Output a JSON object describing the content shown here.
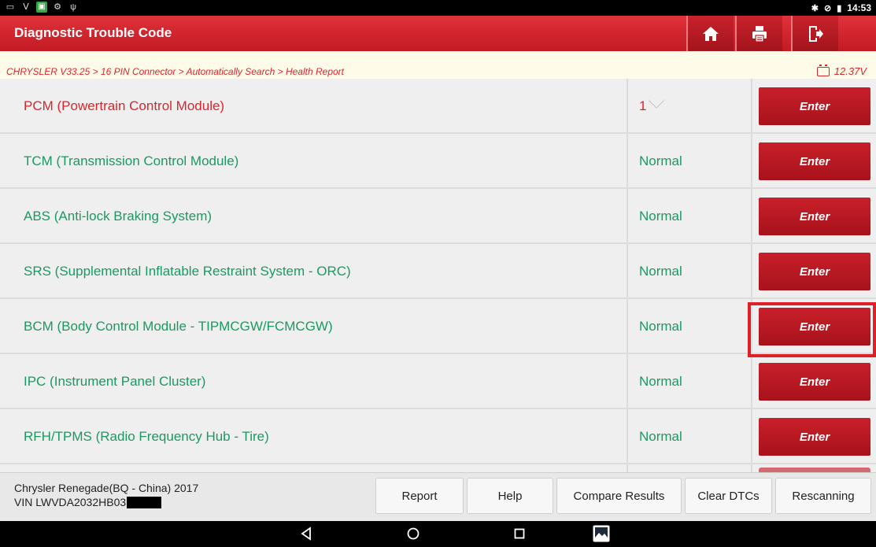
{
  "status_bar": {
    "left_icons": [
      "screen-icon",
      "usb-debug-icon",
      "app-notification-icon",
      "settings-notification-icon",
      "usb-icon"
    ],
    "right_icons": [
      "bluetooth-icon",
      "do-not-disturb-icon",
      "battery-icon"
    ],
    "time": "14:53"
  },
  "header": {
    "title": "Diagnostic Trouble Code",
    "buttons": [
      "home-icon",
      "print-icon",
      "exit-icon"
    ]
  },
  "breadcrumb": {
    "path": "CHRYSLER V33.25 > 16 PIN Connector > Automatically Search > Health Report",
    "voltage": "12.37V"
  },
  "modules": [
    {
      "name": "PCM (Powertrain Control Module)",
      "status": "1",
      "has_dropdown": true,
      "fault": true,
      "action": "Enter"
    },
    {
      "name": "TCM (Transmission Control Module)",
      "status": "Normal",
      "action": "Enter"
    },
    {
      "name": "ABS (Anti-lock Braking System)",
      "status": "Normal",
      "action": "Enter"
    },
    {
      "name": "SRS (Supplemental Inflatable Restraint System - ORC)",
      "status": "Normal",
      "action": "Enter"
    },
    {
      "name": "BCM (Body Control Module - TIPMCGW/FCMCGW)",
      "status": "Normal",
      "action": "Enter",
      "highlighted": true
    },
    {
      "name": "IPC (Instrument Panel Cluster)",
      "status": "Normal",
      "action": "Enter"
    },
    {
      "name": "RFH/TPMS (Radio Frequency Hub - Tire)",
      "status": "Normal",
      "action": "Enter"
    }
  ],
  "footer": {
    "vehicle": "Chrysler Renegade(BQ - China) 2017",
    "vin": "VIN LWVDA2032HB03",
    "buttons": {
      "report": "Report",
      "help": "Help",
      "compare": "Compare Results",
      "clear": "Clear DTCs",
      "rescan": "Rescanning"
    }
  },
  "colors": {
    "accent_red": "#d8262e",
    "normal_green": "#1a9a62",
    "header_red": "#c21a24"
  }
}
